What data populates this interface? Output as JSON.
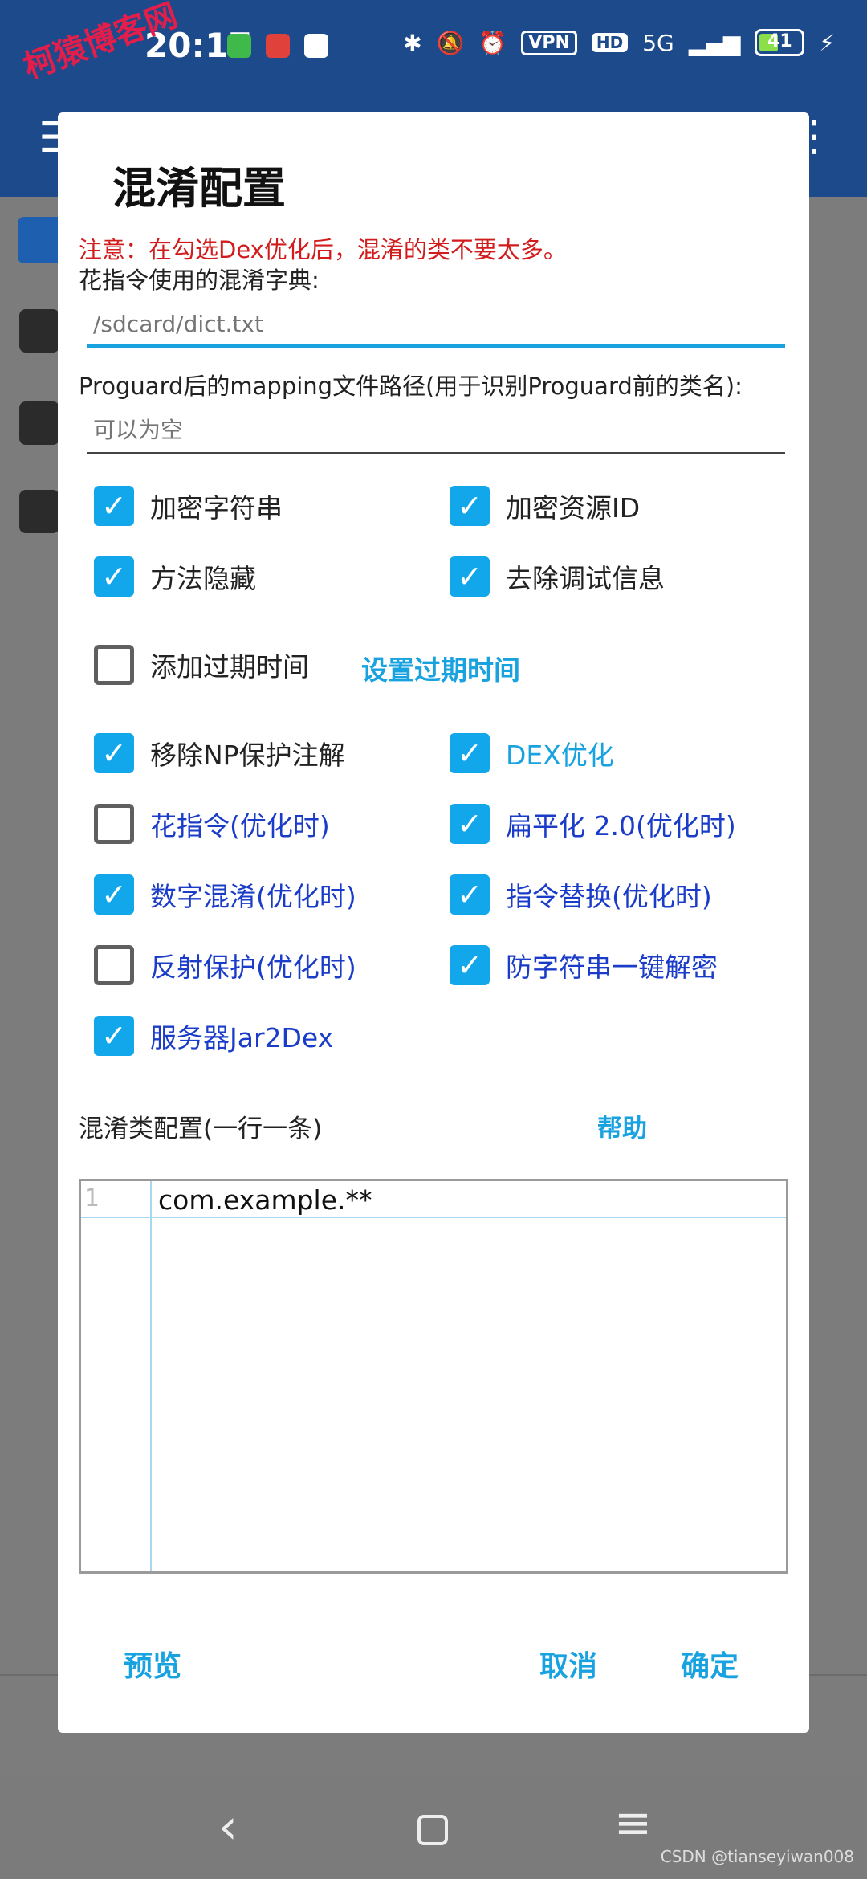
{
  "status_bar": {
    "time": "20:17",
    "network": "5G",
    "vpn": "VPN",
    "hd": "HD",
    "battery": "41"
  },
  "watermark": "柯猿博客网",
  "credit": "CSDN @tianseyiwan008",
  "dialog": {
    "title": "混淆配置",
    "warning": "注意：在勾选Dex优化后，混淆的类不要太多。",
    "dict_label": "花指令使用的混淆字典:",
    "dict_placeholder": "/sdcard/dict.txt",
    "mapping_label": "Proguard后的mapping文件路径(用于识别Proguard前的类名):",
    "mapping_placeholder": "可以为空",
    "checkboxes": [
      {
        "label": "加密字符串",
        "checked": true
      },
      {
        "label": "加密资源ID",
        "checked": true
      },
      {
        "label": "方法隐藏",
        "checked": true
      },
      {
        "label": "去除调试信息",
        "checked": true
      },
      {
        "label": "添加过期时间",
        "checked": false
      },
      {
        "label": "移除NP保护注解",
        "checked": true
      },
      {
        "label": "DEX优化",
        "checked": true
      },
      {
        "label": "花指令(优化时)",
        "checked": false
      },
      {
        "label": "扁平化 2.0(优化时)",
        "checked": true
      },
      {
        "label": "数字混淆(优化时)",
        "checked": true
      },
      {
        "label": "指令替换(优化时)",
        "checked": true
      },
      {
        "label": "反射保护(优化时)",
        "checked": false
      },
      {
        "label": "防字符串一键解密",
        "checked": true
      },
      {
        "label": "服务器Jar2Dex",
        "checked": true
      }
    ],
    "expire_link": "设置过期时间",
    "mix_class_label": "混淆类配置(一行一条)",
    "help_link": "帮助",
    "editor": {
      "line_number": "1",
      "code": "com.example.**"
    },
    "buttons": {
      "preview": "预览",
      "cancel": "取消",
      "confirm": "确定"
    }
  },
  "colors": {
    "accent": "#19a2e0",
    "checkbox": "#11a7ea",
    "warning": "#d21b1b",
    "link_blue": "#1a3cc8"
  }
}
